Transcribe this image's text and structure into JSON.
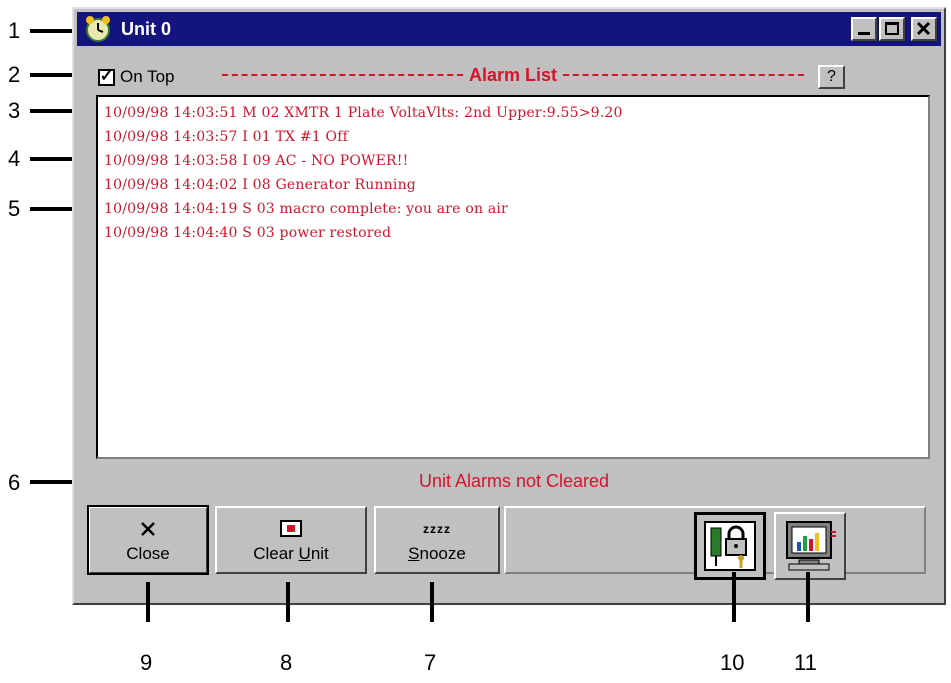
{
  "callouts": {
    "n1": "1",
    "n2": "2",
    "n3": "3",
    "n4": "4",
    "n5": "5",
    "n6": "6",
    "n7": "7",
    "n8": "8",
    "n9": "9",
    "n10": "10",
    "n11": "11"
  },
  "window": {
    "title": "Unit 0",
    "icon": "alarm-clock-icon"
  },
  "toolbar": {
    "on_top_label": "On Top",
    "on_top_checked": true,
    "list_title": "Alarm List",
    "help_label": "?"
  },
  "alarms": [
    "10/09/98 14:03:51 M 02 XMTR 1 Plate VoltaVlts: 2nd Upper:9.55>9.20",
    "10/09/98 14:03:57 I 01 TX #1 Off",
    "10/09/98 14:03:58 I 09 AC - NO POWER!!",
    "10/09/98 14:04:02 I 08 Generator Running",
    "10/09/98 14:04:19 S 03 macro complete: you are on air",
    "10/09/98 14:04:40 S 03 power restored"
  ],
  "status": {
    "text": "Unit Alarms not Cleared"
  },
  "buttons": {
    "close": {
      "label": "Close",
      "icon": "close-icon"
    },
    "clear_unit": {
      "label_pre": "Clear ",
      "label_u": "U",
      "label_post": "nit",
      "icon": "clear-unit-icon"
    },
    "snooze": {
      "label_u": "S",
      "label_post": "nooze",
      "icon": "snooze-icon",
      "glyph": "zzzz"
    },
    "security": {
      "icon": "security-lock-icon"
    },
    "monitor": {
      "icon": "monitor-chart-icon"
    }
  },
  "colors": {
    "alarm_text": "#d4142a",
    "titlebar": "#14147e",
    "window_bg": "#c0c0c0"
  }
}
